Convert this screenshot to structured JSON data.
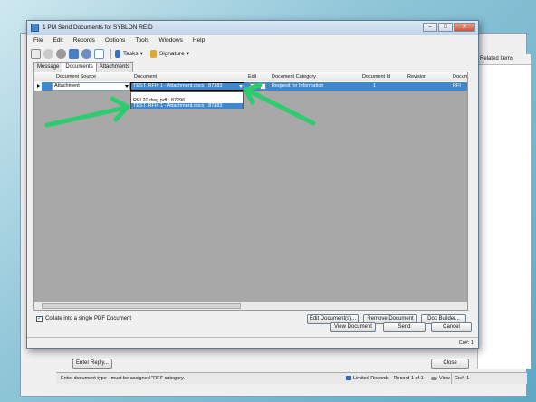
{
  "background_window": {
    "related_items": "Related Items",
    "enter_reply": "Enter Reply...",
    "close": "Close",
    "status_message": "Enter document type - must be assigned \"RFI\" category.",
    "limited_records": "Limited Records - Record 1 of 1",
    "view": "View",
    "co": "Co#: 1"
  },
  "dialog": {
    "title": "1 PM Send Documents for SYBLON REID",
    "menu": [
      "File",
      "Edit",
      "Records",
      "Options",
      "Tools",
      "Windows",
      "Help"
    ],
    "toolbar": {
      "tasks": "Tasks",
      "signature": "Signature"
    },
    "tabs": [
      "Message",
      "Documents",
      "Attachments"
    ],
    "active_tab": "Documents",
    "grid": {
      "headers": {
        "source": "Document Source",
        "document": "Document",
        "edit": "Edit",
        "category": "Document Category",
        "doc_id": "Document Id",
        "revision": "Revision",
        "extra": "Docum"
      },
      "row": {
        "source": "Attachment",
        "document": "TEST. RFI# 1 - Attachment.docx : 87383",
        "category": "Request for Information",
        "doc_id": "1",
        "revision": "",
        "extra": "RFI"
      },
      "dropdown_items": [
        "",
        "RFI 20 dwg.pdf : 87296",
        "TEST. RFI# 1 - Attachment.docx : 87383"
      ]
    },
    "collate_label": "Collate into a single PDF Document",
    "buttons": {
      "edit_documents": "Edit Document(s)...",
      "remove_document": "Remove Document",
      "doc_builder": "Doc Builder...",
      "view_document": "View Document",
      "send": "Send",
      "cancel": "Cancel"
    },
    "status_co": "Co#: 1"
  },
  "colors": {
    "selection": "#3f88d0",
    "arrow": "#2ecc71"
  }
}
